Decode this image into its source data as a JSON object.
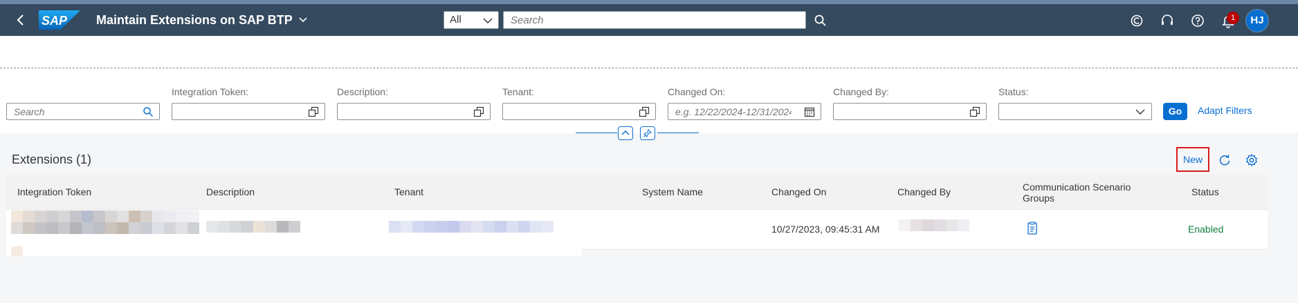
{
  "shell": {
    "app_title": "Maintain Extensions on SAP BTP",
    "logo_text": "SAP",
    "search_scope": "All",
    "search_placeholder": "Search",
    "notification_count": "1",
    "avatar_initials": "HJ",
    "colors": {
      "shell_bg": "#354a5f",
      "accent": "#0a6ed1",
      "badge": "#bb0000"
    }
  },
  "filterbar": {
    "search_placeholder": "Search",
    "fields": [
      {
        "label": "Integration Token:",
        "value": "",
        "placeholder": ""
      },
      {
        "label": "Description:",
        "value": "",
        "placeholder": ""
      },
      {
        "label": "Tenant:",
        "value": "",
        "placeholder": ""
      },
      {
        "label": "Changed On:",
        "value": "",
        "placeholder": "e.g. 12/22/2024-12/31/2024"
      },
      {
        "label": "Changed By:",
        "value": "",
        "placeholder": ""
      },
      {
        "label": "Status:",
        "value": "",
        "placeholder": ""
      }
    ],
    "go_label": "Go",
    "adapt_label": "Adapt Filters"
  },
  "table": {
    "title": "Extensions (1)",
    "new_label": "New",
    "columns": [
      "Integration Token",
      "Description",
      "Tenant",
      "System Name",
      "Changed On",
      "Changed By",
      "Communication Scenario Groups",
      "Status"
    ],
    "rows": [
      {
        "integration_token": "",
        "description": "",
        "tenant": "",
        "system_name": "",
        "changed_on": "10/27/2023, 09:45:31 AM",
        "changed_by": "",
        "communication_scenario_groups_icon": "document-icon",
        "status": "Enabled"
      }
    ],
    "status_color": "#107e3e"
  }
}
